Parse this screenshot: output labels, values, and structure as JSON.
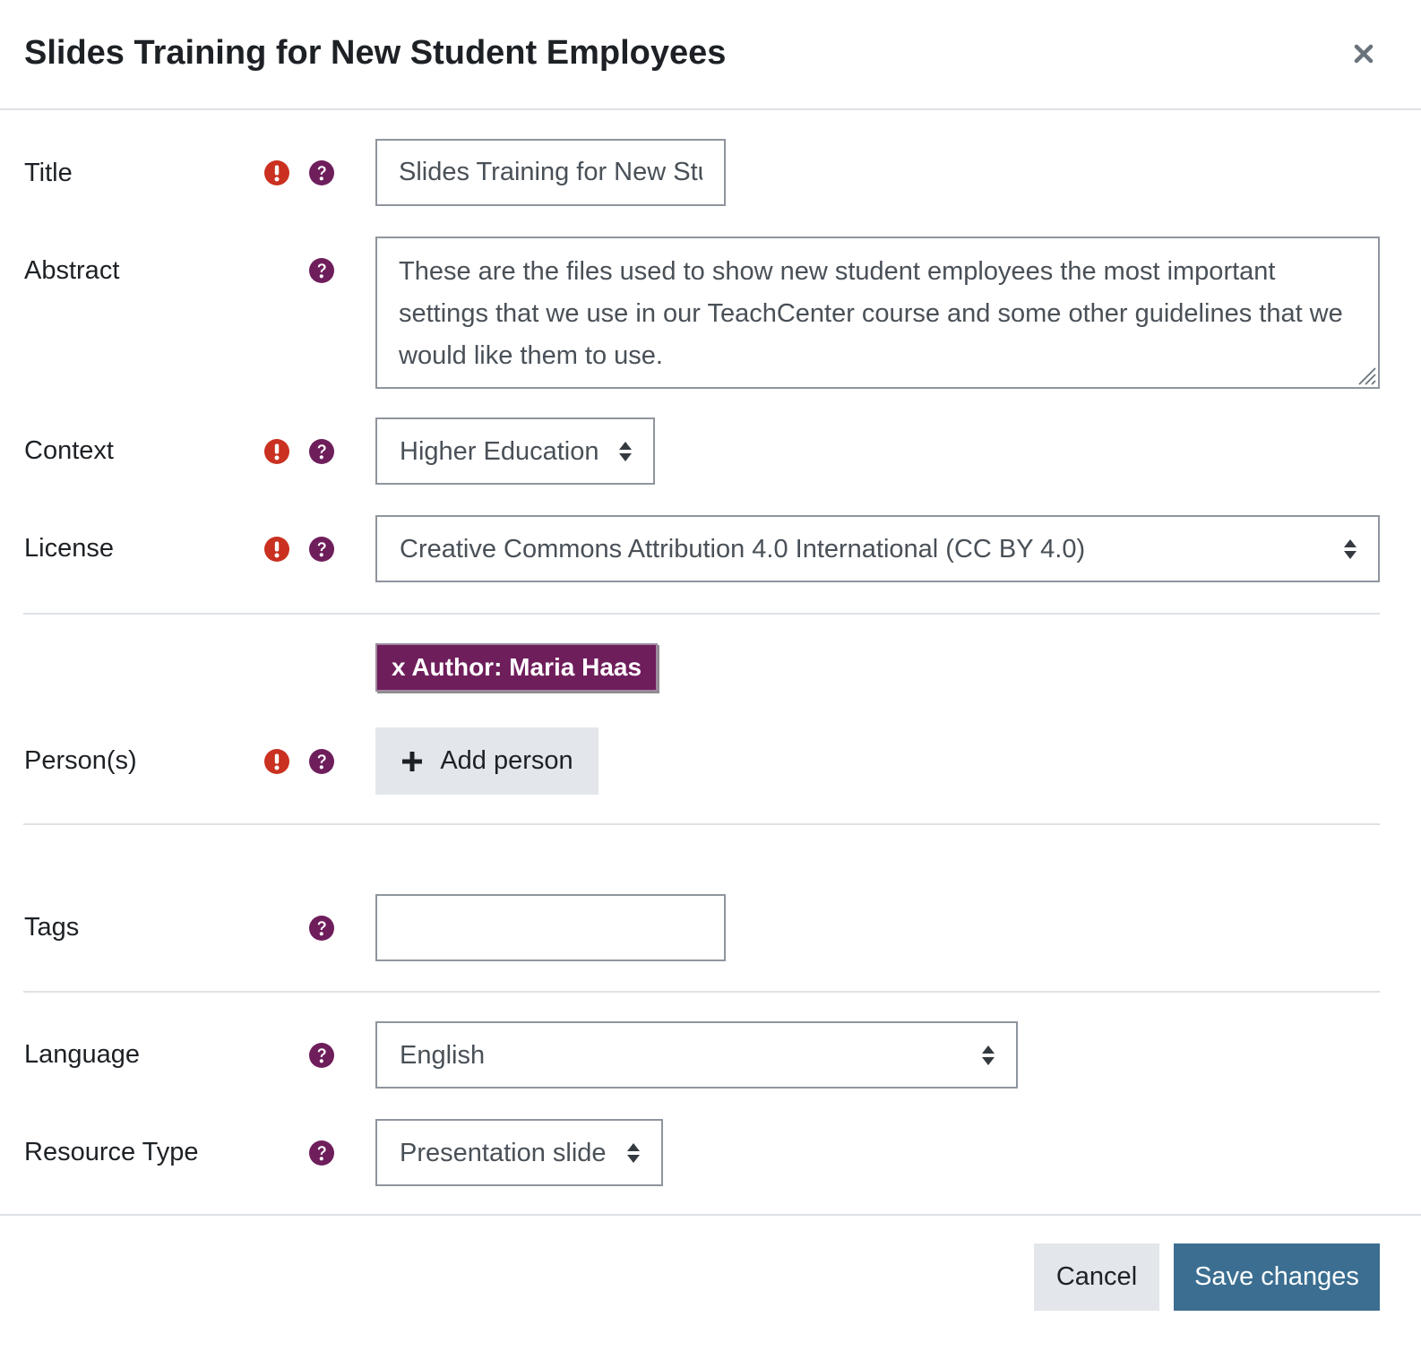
{
  "dialog": {
    "title": "Slides Training for New Student Employees"
  },
  "form": {
    "title": {
      "label": "Title",
      "value": "Slides Training for New Student Employees",
      "required": true
    },
    "abstract": {
      "label": "Abstract",
      "value": "These are the files used to show new student employees the most important settings that we use in our TeachCenter course and some other guidelines that we would like them to use.",
      "required": false
    },
    "context": {
      "label": "Context",
      "value": "Higher Education",
      "required": true
    },
    "license": {
      "label": "License",
      "value": "Creative Commons Attribution 4.0 International (CC BY 4.0)",
      "required": true
    },
    "persons": {
      "label": "Person(s)",
      "chip": "x Author: Maria Haas",
      "add_label": "Add person",
      "required": true
    },
    "tags": {
      "label": "Tags",
      "value": ""
    },
    "language": {
      "label": "Language",
      "value": "English"
    },
    "resource_type": {
      "label": "Resource Type",
      "value": "Presentation slide"
    }
  },
  "footer": {
    "cancel_label": "Cancel",
    "save_label": "Save changes"
  },
  "icons": {
    "required": "exclamation-circle-icon",
    "help": "question-circle-icon",
    "close": "close-icon",
    "caret": "sort-caret-icon",
    "add": "plus-icon"
  },
  "colors": {
    "required": "#ca3120",
    "help": "#6f1e5c",
    "chip": "#6f1e5c",
    "primary": "#3b6e91",
    "secondary": "#e3e6ea"
  }
}
